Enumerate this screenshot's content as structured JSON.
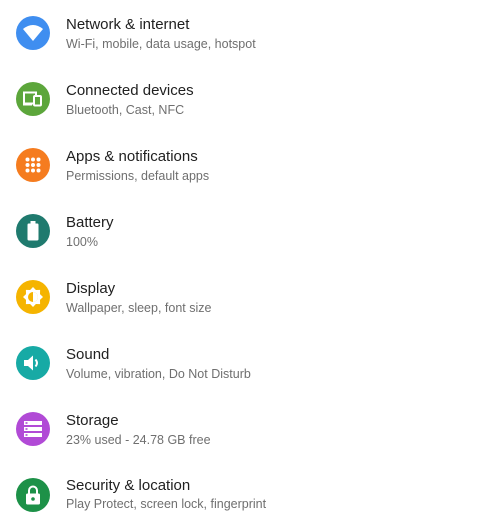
{
  "settings": {
    "items": [
      {
        "title": "Network & internet",
        "summary": "Wi-Fi, mobile, data usage, hotspot",
        "icon": "wifi-icon",
        "color": "#3f8ef0"
      },
      {
        "title": "Connected devices",
        "summary": "Bluetooth, Cast, NFC",
        "icon": "devices-icon",
        "color": "#5ca63b"
      },
      {
        "title": "Apps & notifications",
        "summary": "Permissions, default apps",
        "icon": "apps-grid-icon",
        "color": "#f57c1f"
      },
      {
        "title": "Battery",
        "summary": "100%",
        "icon": "battery-icon",
        "color": "#1f7a6e"
      },
      {
        "title": "Display",
        "summary": "Wallpaper, sleep, font size",
        "icon": "brightness-icon",
        "color": "#f5b400"
      },
      {
        "title": "Sound",
        "summary": "Volume, vibration, Do Not Disturb",
        "icon": "volume-icon",
        "color": "#17aaa5"
      },
      {
        "title": "Storage",
        "summary": "23% used - 24.78 GB free",
        "icon": "storage-icon",
        "color": "#b14ad6"
      },
      {
        "title": "Security & location",
        "summary": "Play Protect, screen lock, fingerprint",
        "icon": "lock-icon",
        "color": "#1d9148"
      }
    ]
  }
}
